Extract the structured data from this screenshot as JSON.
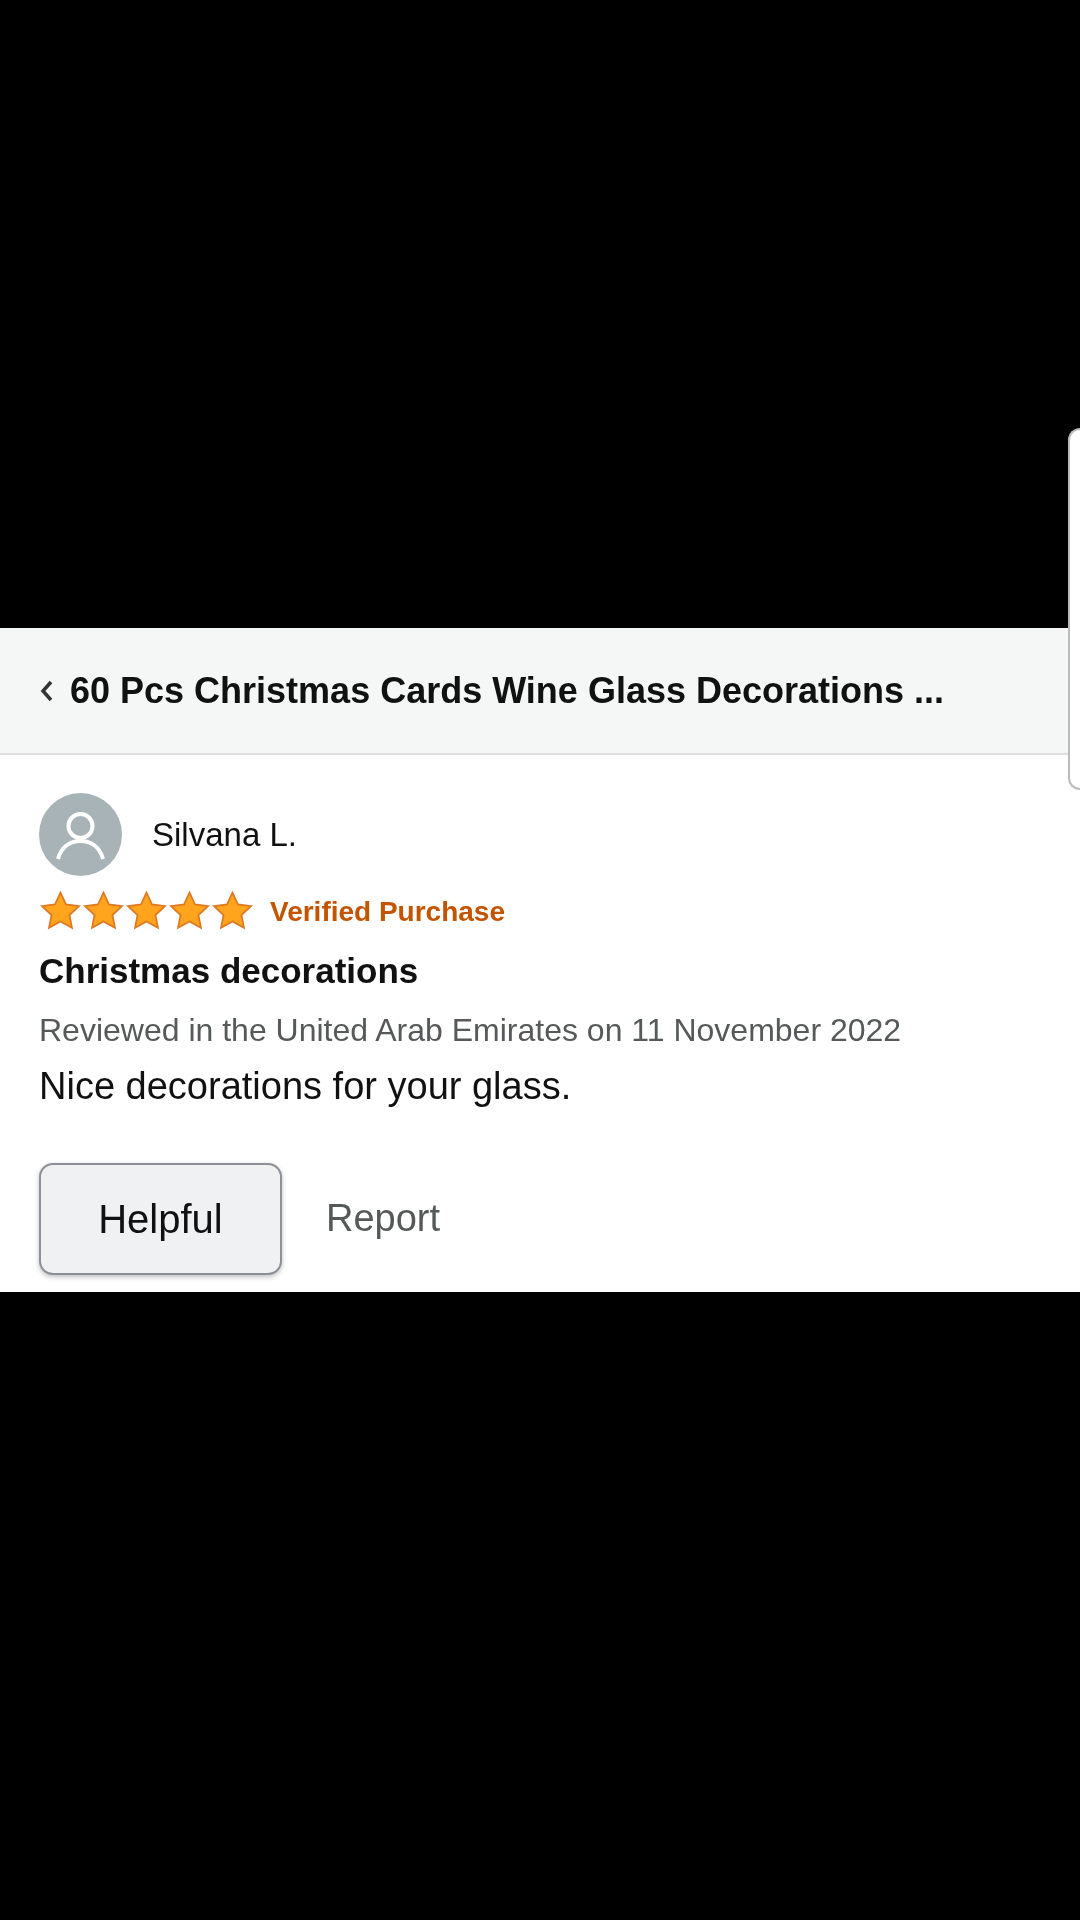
{
  "header": {
    "title": "60 Pcs Christmas Cards Wine Glass Decorations ..."
  },
  "review": {
    "author": "Silvana L.",
    "stars": 5,
    "badge": "Verified Purchase",
    "title": "Christmas decorations",
    "meta": "Reviewed in the United Arab Emirates on 11 November 2022",
    "body": "Nice decorations for your glass."
  },
  "actions": [
    "Helpful",
    "Report"
  ]
}
